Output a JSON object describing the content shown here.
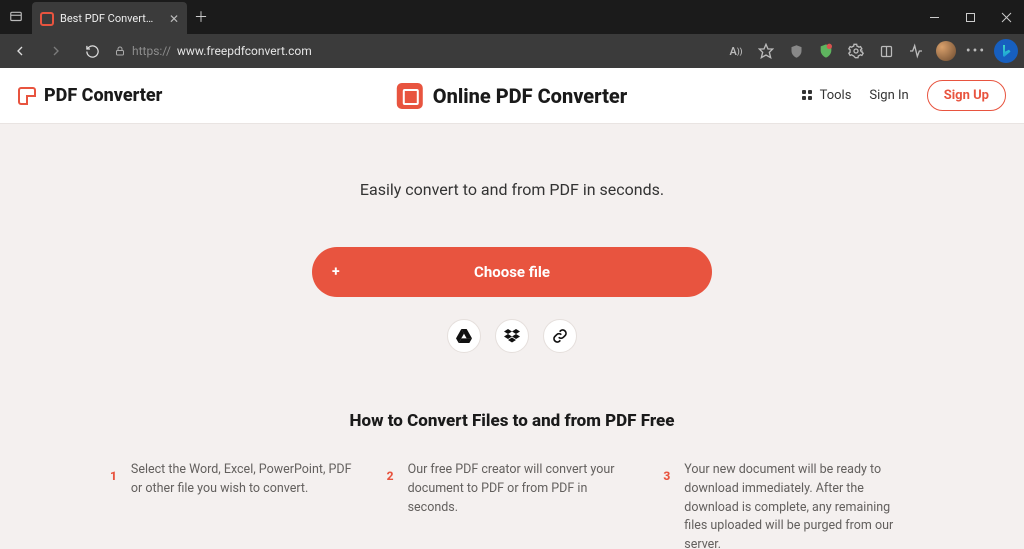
{
  "browser": {
    "tab_title": "Best PDF Converter: Create, Convert",
    "url_scheme": "https://",
    "url_host": "www.freepdfconvert.com",
    "url_path": ""
  },
  "header": {
    "brand": "PDF Converter",
    "center_title": "Online PDF Converter",
    "tools_label": "Tools",
    "signin_label": "Sign In",
    "signup_label": "Sign Up"
  },
  "main": {
    "tagline": "Easily convert to and from PDF in seconds.",
    "choose_file_label": "Choose file",
    "plus_symbol": "+"
  },
  "howto": {
    "heading": "How to Convert Files to and from PDF Free",
    "steps": [
      {
        "n": "1",
        "text": "Select the Word, Excel, PowerPoint, PDF or other file you wish to convert."
      },
      {
        "n": "2",
        "text": "Our free PDF creator will convert your document to PDF or from PDF in seconds."
      },
      {
        "n": "3",
        "text": "Your new document will be ready to download immediately. After the download is complete, any remaining files uploaded will be purged from our server."
      }
    ]
  },
  "icons": {
    "gdrive": "google-drive-icon",
    "dropbox": "dropbox-icon",
    "link": "link-icon"
  },
  "colors": {
    "accent": "#e8543f",
    "page_bg": "#f4f0ef"
  }
}
